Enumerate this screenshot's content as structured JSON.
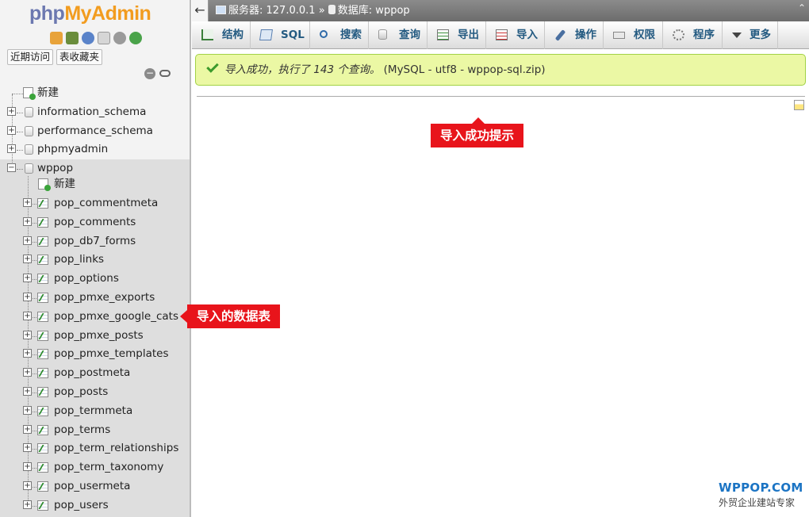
{
  "sidebar": {
    "logo_part1": "php",
    "logo_part2": "MyAdmin",
    "quick_links": [
      "近期访问",
      "表收藏夹"
    ],
    "collapse_symbol": "−",
    "new_label": "新建",
    "databases": [
      "information_schema",
      "performance_schema",
      "phpmyadmin",
      "wppop"
    ],
    "wppop_new_label": "新建",
    "tables": [
      "pop_commentmeta",
      "pop_comments",
      "pop_db7_forms",
      "pop_links",
      "pop_options",
      "pop_pmxe_exports",
      "pop_pmxe_google_cats",
      "pop_pmxe_posts",
      "pop_pmxe_templates",
      "pop_postmeta",
      "pop_posts",
      "pop_termmeta",
      "pop_terms",
      "pop_term_relationships",
      "pop_term_taxonomy",
      "pop_usermeta",
      "pop_users"
    ]
  },
  "breadcrumb": {
    "back_symbol": "←",
    "server": "服务器: 127.0.0.1",
    "separator": "»",
    "database": "数据库: wppop",
    "up_symbol": "⌃"
  },
  "menu": [
    {
      "label": "结构",
      "icon": "structure-icon"
    },
    {
      "label": "SQL",
      "icon": "sql-icon"
    },
    {
      "label": "搜索",
      "icon": "search-icon"
    },
    {
      "label": "查询",
      "icon": "query-icon"
    },
    {
      "label": "导出",
      "icon": "export-icon"
    },
    {
      "label": "导入",
      "icon": "import-icon"
    },
    {
      "label": "操作",
      "icon": "operations-icon"
    },
    {
      "label": "权限",
      "icon": "privileges-icon"
    },
    {
      "label": "程序",
      "icon": "routines-icon"
    },
    {
      "label": "更多",
      "icon": "more-icon"
    }
  ],
  "success": {
    "message": "导入成功，执行了 143 个查询。",
    "detail": "(MySQL - utf8 - wppop-sql.zip)"
  },
  "annotations": {
    "top": "导入成功提示",
    "left": "导入的数据表"
  },
  "watermark": {
    "brand": "WPPOP.COM",
    "subtitle": "外贸企业建站专家"
  },
  "colors": {
    "accent_red": "#e8141b",
    "success_bg": "#ebf8a4",
    "link_blue": "#235a81"
  }
}
